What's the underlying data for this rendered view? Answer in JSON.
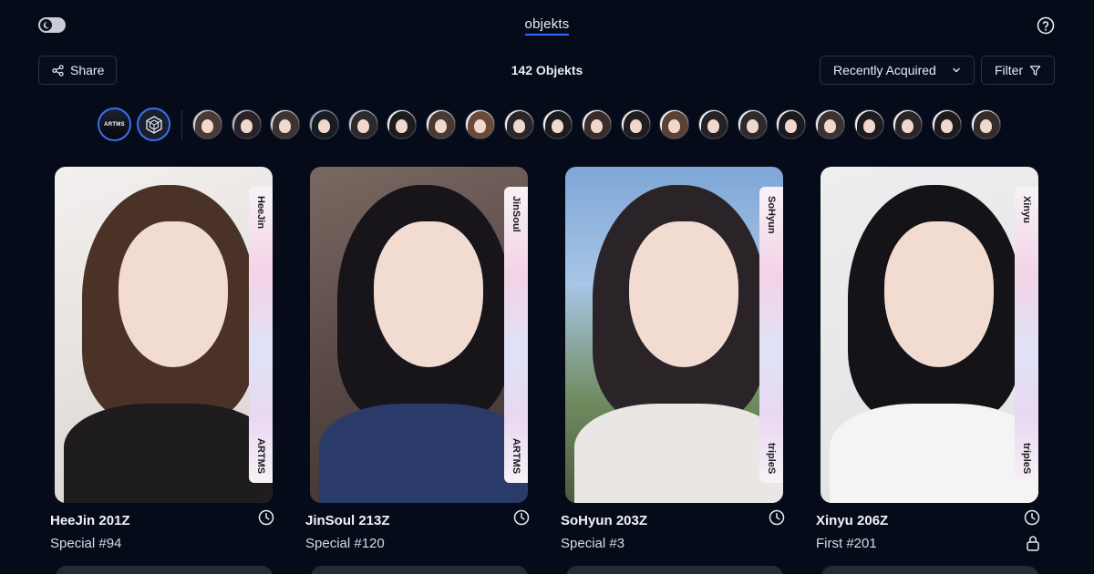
{
  "nav": {
    "title": "objekts"
  },
  "toolbar": {
    "share_label": "Share",
    "count_label": "142 Objekts",
    "sort_label": "Recently Acquired",
    "filter_label": "Filter"
  },
  "groups": [
    {
      "name": "ARTMS",
      "selected": true
    },
    {
      "name": "tripleS",
      "selected": true
    }
  ],
  "colors": {
    "background": "#060b1a",
    "accent": "#2f6bff",
    "border": "#2b3346"
  },
  "cards": [
    {
      "member": "HeeJin",
      "serial": "HeeJin 201Z",
      "collection": "Special #94",
      "group_mark": "ARTMS",
      "status_icon": "clock-icon"
    },
    {
      "member": "JinSoul",
      "serial": "JinSoul 213Z",
      "collection": "Special #120",
      "group_mark": "ARTMS",
      "status_icon": "clock-icon"
    },
    {
      "member": "SoHyun",
      "serial": "SoHyun 203Z",
      "collection": "Special #3",
      "group_mark": "tripleS",
      "status_icon": "clock-icon"
    },
    {
      "member": "Xinyu",
      "serial": "Xinyu 206Z",
      "collection": "First #201",
      "group_mark": "tripleS",
      "status_icon": "clock-icon",
      "extra_icon": "lock-icon"
    }
  ]
}
